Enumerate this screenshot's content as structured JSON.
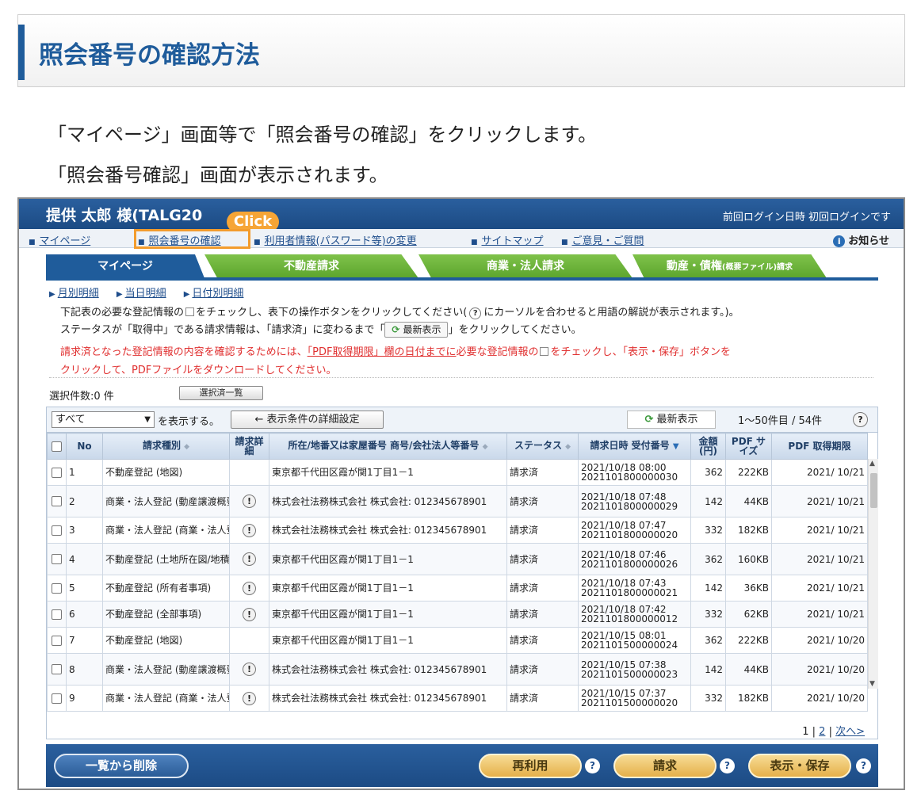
{
  "heading": "照会番号の確認方法",
  "intro": {
    "line1": "「マイページ」画面等で「照会番号の確認」をクリックします。",
    "line2": "「照会番号確認」画面が表示されます。"
  },
  "screenshot": {
    "user_name": "提供 太郎 様(TALG20",
    "last_login": "前回ログイン日時 初回ログインです",
    "click_label": "Click",
    "nav_links": [
      "マイページ",
      "照会番号の確認",
      "利用者情報(パスワード等)の変更",
      "サイトマップ",
      "ご意見・ご質問"
    ],
    "notice": "お知らせ",
    "tabs": [
      "マイページ",
      "不動産請求",
      "商業・法人請求",
      "動産・債権",
      "(概要ファイル)請求"
    ],
    "sub_links": [
      "月別明細",
      "当日明細",
      "日付別明細"
    ],
    "inst1a": "下記表の必要な登記情報の",
    "inst1b": "をチェックし、表下の操作ボタンをクリックしてください(",
    "inst1c": "にカーソルを合わせると用語の解説が表示されます。)。",
    "inst2a": "ステータスが「取得中」である請求情報は、「請求済」に変わるまで「",
    "inst2b": "」をクリックしてください。",
    "inst3a": "請求済となった登記情報の内容を確認するためには、",
    "inst3link": "「PDF取得期限」欄の日付までに",
    "inst3b": "必要な登記情報の",
    "inst3c": "をチェックし、「表示・保存」ボタンを",
    "inst4": "クリックして、PDFファイルをダウンロードしてください。",
    "refresh_label": "最新表示",
    "selected_count": "選択件数:0 件",
    "selected_list_btn": "選択済一覧",
    "filter_select": "すべて",
    "filter_text": "を表示する。",
    "condition_btn": "← 表示条件の詳細設定",
    "page_range": "1〜50件目 / 54件",
    "help": "?",
    "columns": {
      "no": "No",
      "type": "請求種別",
      "detail": "請求詳細",
      "location": "所在/地番又は家屋番号 商号/会社法人等番号",
      "status": "ステータス",
      "datetime": "請求日時 受付番号",
      "amount": "金額 (円)",
      "pdf_size": "PDF サイズ",
      "pdf_deadline": "PDF 取得期限"
    },
    "rows": [
      {
        "no": "1",
        "type": "不動産登記 (地図)",
        "detail": false,
        "loc": "東京都千代田区霞が関1丁目1－1",
        "status": "請求済",
        "dt1": "2021/10/18 08:00",
        "dt2": "2021101800000030",
        "amount": "362",
        "size": "222KB",
        "deadline": "2021/ 10/21"
      },
      {
        "no": "2",
        "type": "商業・法人登記 (動産譲渡概要 現在事項)",
        "detail": true,
        "loc": "株式会社法務株式会社 株式会社: 012345678901",
        "status": "請求済",
        "dt1": "2021/10/18 07:48",
        "dt2": "2021101800000029",
        "amount": "142",
        "size": "44KB",
        "deadline": "2021/ 10/21"
      },
      {
        "no": "3",
        "type": "商業・法人登記 (商業・法人登記簿)",
        "detail": true,
        "loc": "株式会社法務株式会社 株式会社: 012345678901",
        "status": "請求済",
        "dt1": "2021/10/18 07:47",
        "dt2": "2021101800000020",
        "amount": "332",
        "size": "182KB",
        "deadline": "2021/ 10/21"
      },
      {
        "no": "4",
        "type": "不動産登記 (土地所在図/地積測量図)",
        "detail": true,
        "loc": "東京都千代田区霞が関1丁目1－1",
        "status": "請求済",
        "dt1": "2021/10/18 07:46",
        "dt2": "2021101800000026",
        "amount": "362",
        "size": "160KB",
        "deadline": "2021/ 10/21"
      },
      {
        "no": "5",
        "type": "不動産登記 (所有者事項)",
        "detail": true,
        "loc": "東京都千代田区霞が関1丁目1－1",
        "status": "請求済",
        "dt1": "2021/10/18 07:43",
        "dt2": "2021101800000021",
        "amount": "142",
        "size": "36KB",
        "deadline": "2021/ 10/21"
      },
      {
        "no": "6",
        "type": "不動産登記 (全部事項)",
        "detail": true,
        "loc": "東京都千代田区霞が関1丁目1－1",
        "status": "請求済",
        "dt1": "2021/10/18 07:42",
        "dt2": "2021101800000012",
        "amount": "332",
        "size": "62KB",
        "deadline": "2021/ 10/21"
      },
      {
        "no": "7",
        "type": "不動産登記 (地図)",
        "detail": false,
        "loc": "東京都千代田区霞が関1丁目1－1",
        "status": "請求済",
        "dt1": "2021/10/15 08:01",
        "dt2": "2021101500000024",
        "amount": "362",
        "size": "222KB",
        "deadline": "2021/ 10/20"
      },
      {
        "no": "8",
        "type": "商業・法人登記 (動産譲渡概要 閉鎖事項)",
        "detail": true,
        "loc": "株式会社法務株式会社 株式会社: 012345678901",
        "status": "請求済",
        "dt1": "2021/10/15 07:38",
        "dt2": "2021101500000023",
        "amount": "142",
        "size": "44KB",
        "deadline": "2021/ 10/20"
      },
      {
        "no": "9",
        "type": "商業・法人登記 (商業・法人登記簿)",
        "detail": true,
        "loc": "株式会社法務株式会社 株式会社: 012345678901",
        "status": "請求済",
        "dt1": "2021/10/15 07:37",
        "dt2": "2021101500000020",
        "amount": "332",
        "size": "182KB",
        "deadline": "2021/ 10/20"
      }
    ],
    "pager": {
      "current": "1",
      "sep1": "|",
      "page2": "2",
      "sep2": "|",
      "next": "次へ>"
    },
    "buttons": {
      "delete": "一覧から削除",
      "reuse": "再利用",
      "request": "請求",
      "view_save": "表示・保存",
      "q": "?"
    }
  }
}
